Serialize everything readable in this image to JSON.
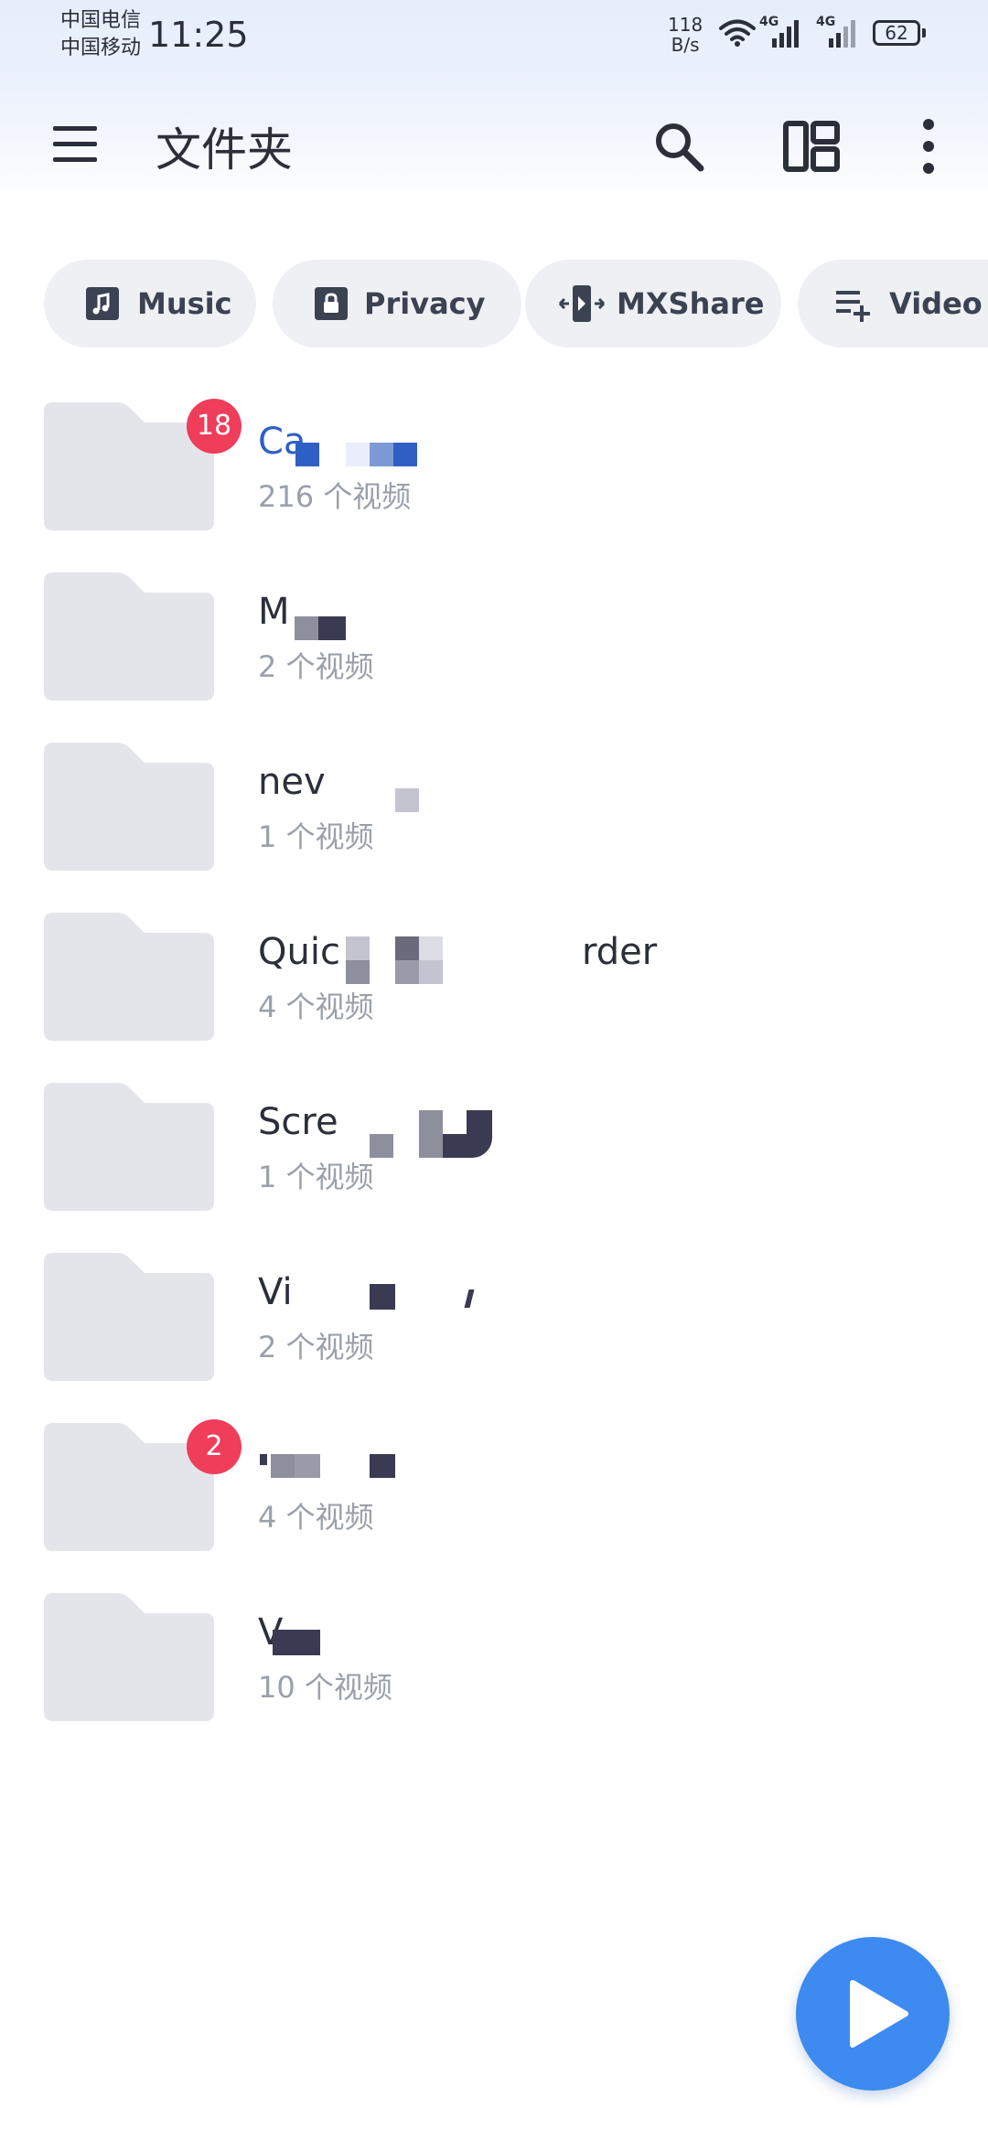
{
  "status_bar": {
    "carrier_1": "中国电信",
    "carrier_2": "中国移动",
    "time": "11:25",
    "net_speed_value": "118",
    "net_speed_unit": "B/s",
    "signal_1_label": "4G",
    "signal_2_label": "4G",
    "battery": "62"
  },
  "app_bar": {
    "title": "文件夹"
  },
  "chips": [
    {
      "label": "Music",
      "icon": "music-note-icon"
    },
    {
      "label": "Privacy",
      "icon": "lock-icon"
    },
    {
      "label": "MXShare",
      "icon": "share-transfer-icon"
    },
    {
      "label": "Video P",
      "icon": "playlist-add-icon"
    }
  ],
  "folders": [
    {
      "name": "Ca",
      "count": "216 个视频",
      "badge": "18",
      "highlight": true
    },
    {
      "name": "M",
      "count": "2 个视频",
      "badge": "",
      "highlight": false
    },
    {
      "name": "nev",
      "count": "1 个视频",
      "badge": "",
      "highlight": false
    },
    {
      "name": "Quic",
      "name_tail": "rder",
      "count": "4 个视频",
      "badge": "",
      "highlight": false
    },
    {
      "name": "Scre",
      "count": "1 个视频",
      "badge": "",
      "highlight": false
    },
    {
      "name": "Vi",
      "count": "2 个视频",
      "badge": "",
      "highlight": false
    },
    {
      "name": "",
      "count": "4 个视频",
      "badge": "2",
      "highlight": false
    },
    {
      "name": "V",
      "count": "10 个视频",
      "badge": "",
      "highlight": false
    }
  ],
  "colors": {
    "accent": "#3d8af0",
    "badge": "#ef3d5a",
    "folder": "#e3e5ea",
    "highlight_text": "#2f5fc4"
  }
}
